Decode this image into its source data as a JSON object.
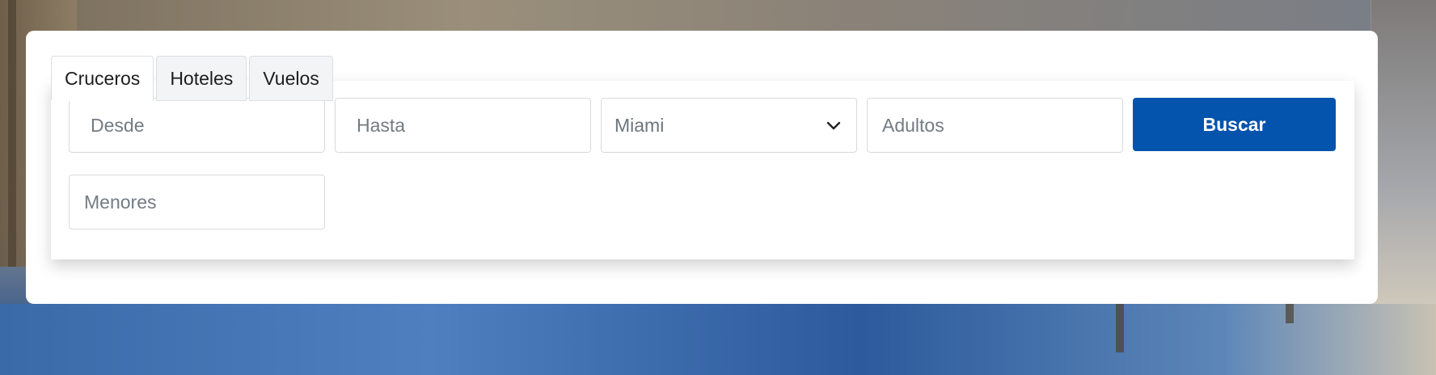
{
  "tabs": [
    {
      "label": "Cruceros",
      "active": true
    },
    {
      "label": "Hoteles",
      "active": false
    },
    {
      "label": "Vuelos",
      "active": false
    }
  ],
  "form": {
    "desde": {
      "placeholder": "Desde",
      "value": ""
    },
    "hasta": {
      "placeholder": "Hasta",
      "value": ""
    },
    "destino": {
      "selected": "Miami"
    },
    "adultos": {
      "placeholder": "Adultos",
      "value": ""
    },
    "menores": {
      "placeholder": "Menores",
      "value": ""
    },
    "search_label": "Buscar"
  },
  "icons": {
    "dropdown": "chevron-down-icon"
  },
  "colors": {
    "accent": "#0453ac",
    "tab_inactive": "#f3f4f6",
    "border": "#d7dade"
  }
}
